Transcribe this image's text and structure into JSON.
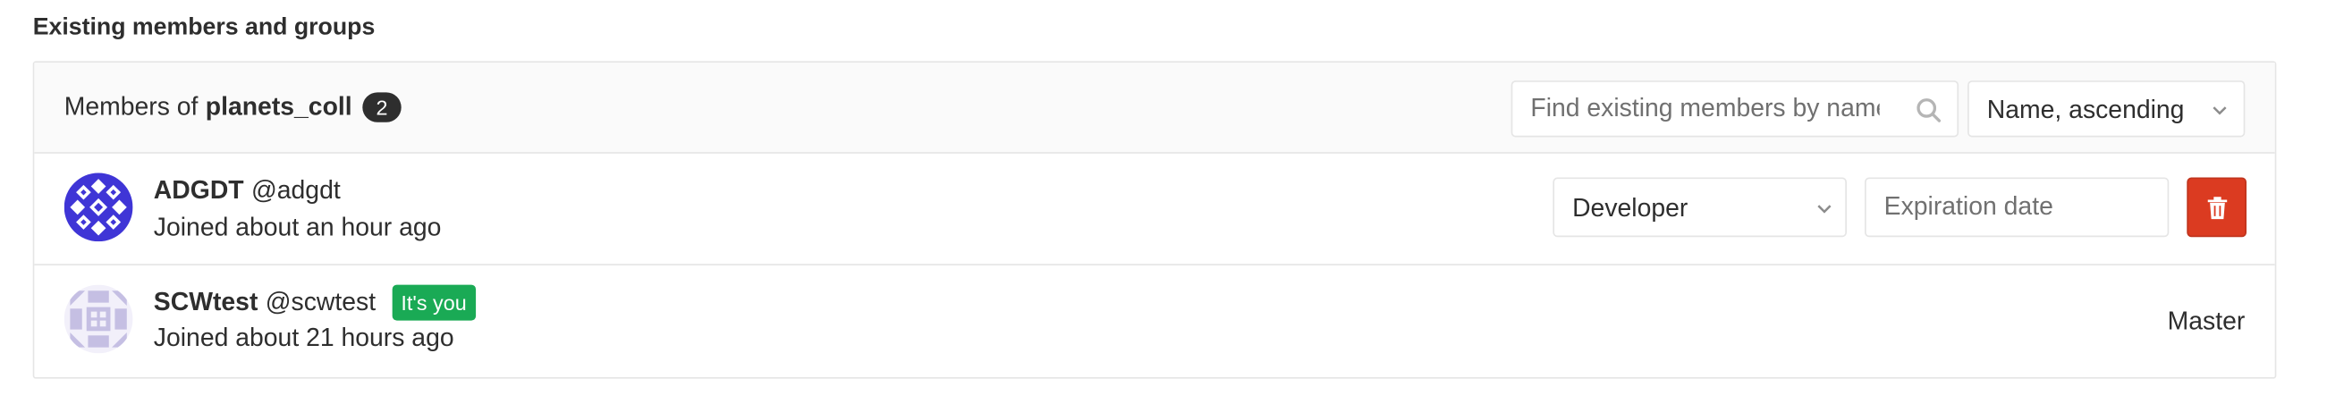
{
  "section": {
    "title": "Existing members and groups"
  },
  "header": {
    "members_of_prefix": "Members of",
    "group_name": "planets_coll",
    "member_count": "2",
    "search_placeholder": "Find existing members by name",
    "search_icon": "search-icon",
    "sort_label": "Name, ascending",
    "sort_icon": "chevron-down-icon"
  },
  "members": [
    {
      "name": "ADGDT",
      "username": "@adgdt",
      "joined": "Joined about an hour ago",
      "role": "Developer",
      "expiration_placeholder": "Expiration date",
      "delete_icon": "trash-icon",
      "avatar_color": "#3f35d6"
    },
    {
      "name": "SCWtest",
      "username": "@scwtest",
      "badge": "It's you",
      "joined": "Joined about 21 hours ago",
      "role": "Master",
      "avatar_color": "#c5bfe3"
    }
  ],
  "colors": {
    "badge_dark": "#2e2e2e",
    "its_you_green": "#1aaa55",
    "delete_red": "#db3b21",
    "border": "#e5e5e5",
    "header_bg": "#fafafa"
  }
}
